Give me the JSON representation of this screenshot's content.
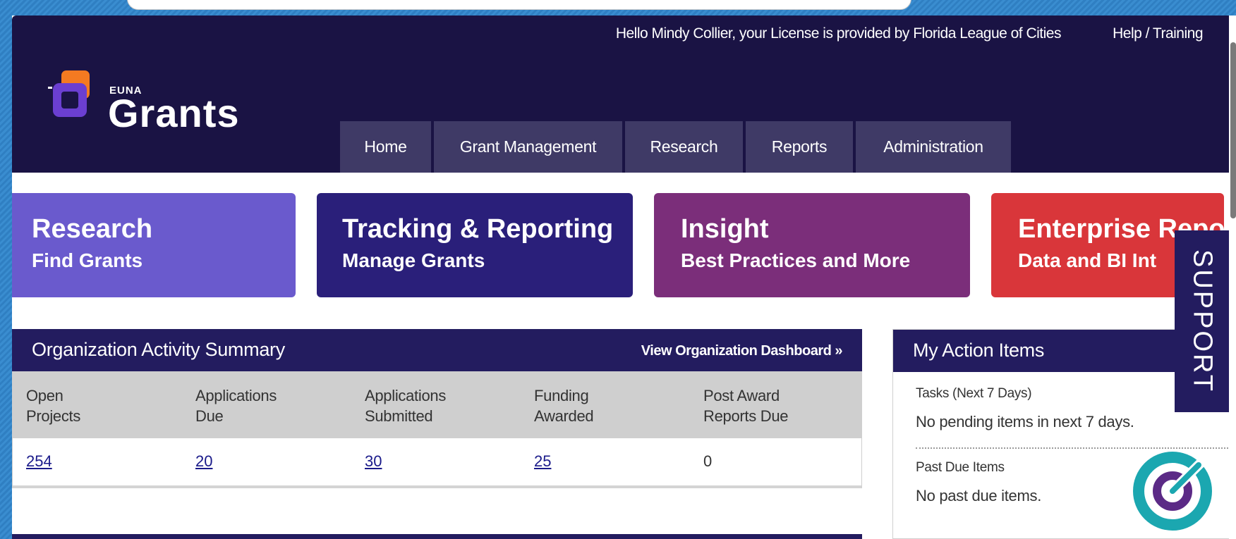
{
  "header": {
    "greeting": "Hello Mindy Collier, your License is provided by Florida League of Cities",
    "help_link": "Help / Training",
    "logo_small": "EUNA",
    "logo_big": "Grants"
  },
  "nav": {
    "items": [
      {
        "label": "Home"
      },
      {
        "label": "Grant Management"
      },
      {
        "label": "Research"
      },
      {
        "label": "Reports"
      },
      {
        "label": "Administration"
      }
    ]
  },
  "tiles": [
    {
      "title": "Research",
      "subtitle": "Find Grants",
      "color": "#6a5acd"
    },
    {
      "title": "Tracking & Reporting",
      "subtitle": "Manage Grants",
      "color": "#2a1f7a"
    },
    {
      "title": "Insight",
      "subtitle": "Best Practices and More",
      "color": "#7b2e7a"
    },
    {
      "title": "Enterprise Repo",
      "subtitle": "Data and BI Int",
      "color": "#d9363a"
    }
  ],
  "support": {
    "label": "SUPPORT"
  },
  "summary": {
    "title": "Organization Activity Summary",
    "dashboard_link": "View Organization Dashboard »",
    "columns": [
      {
        "line1": "Open",
        "line2": "Projects",
        "value": "254"
      },
      {
        "line1": "Applications",
        "line2": "Due",
        "value": "20"
      },
      {
        "line1": "Applications",
        "line2": "Submitted",
        "value": "30"
      },
      {
        "line1": "Funding",
        "line2": "Awarded",
        "value": "25"
      },
      {
        "line1": "Post Award",
        "line2": "Reports Due",
        "value": "0"
      }
    ]
  },
  "actions": {
    "title": "My Action Items",
    "tasks_label": "Tasks (Next 7 Days)",
    "tasks_text": "No pending items in next 7 days.",
    "past_label": "Past Due Items",
    "past_text": "No past due items."
  },
  "colors": {
    "header_bg": "#1a1344",
    "panel_head": "#231c5f",
    "nav_item": "#3f3a66",
    "chat_teal": "#1ba7b0",
    "chat_purple": "#5b2a86"
  }
}
